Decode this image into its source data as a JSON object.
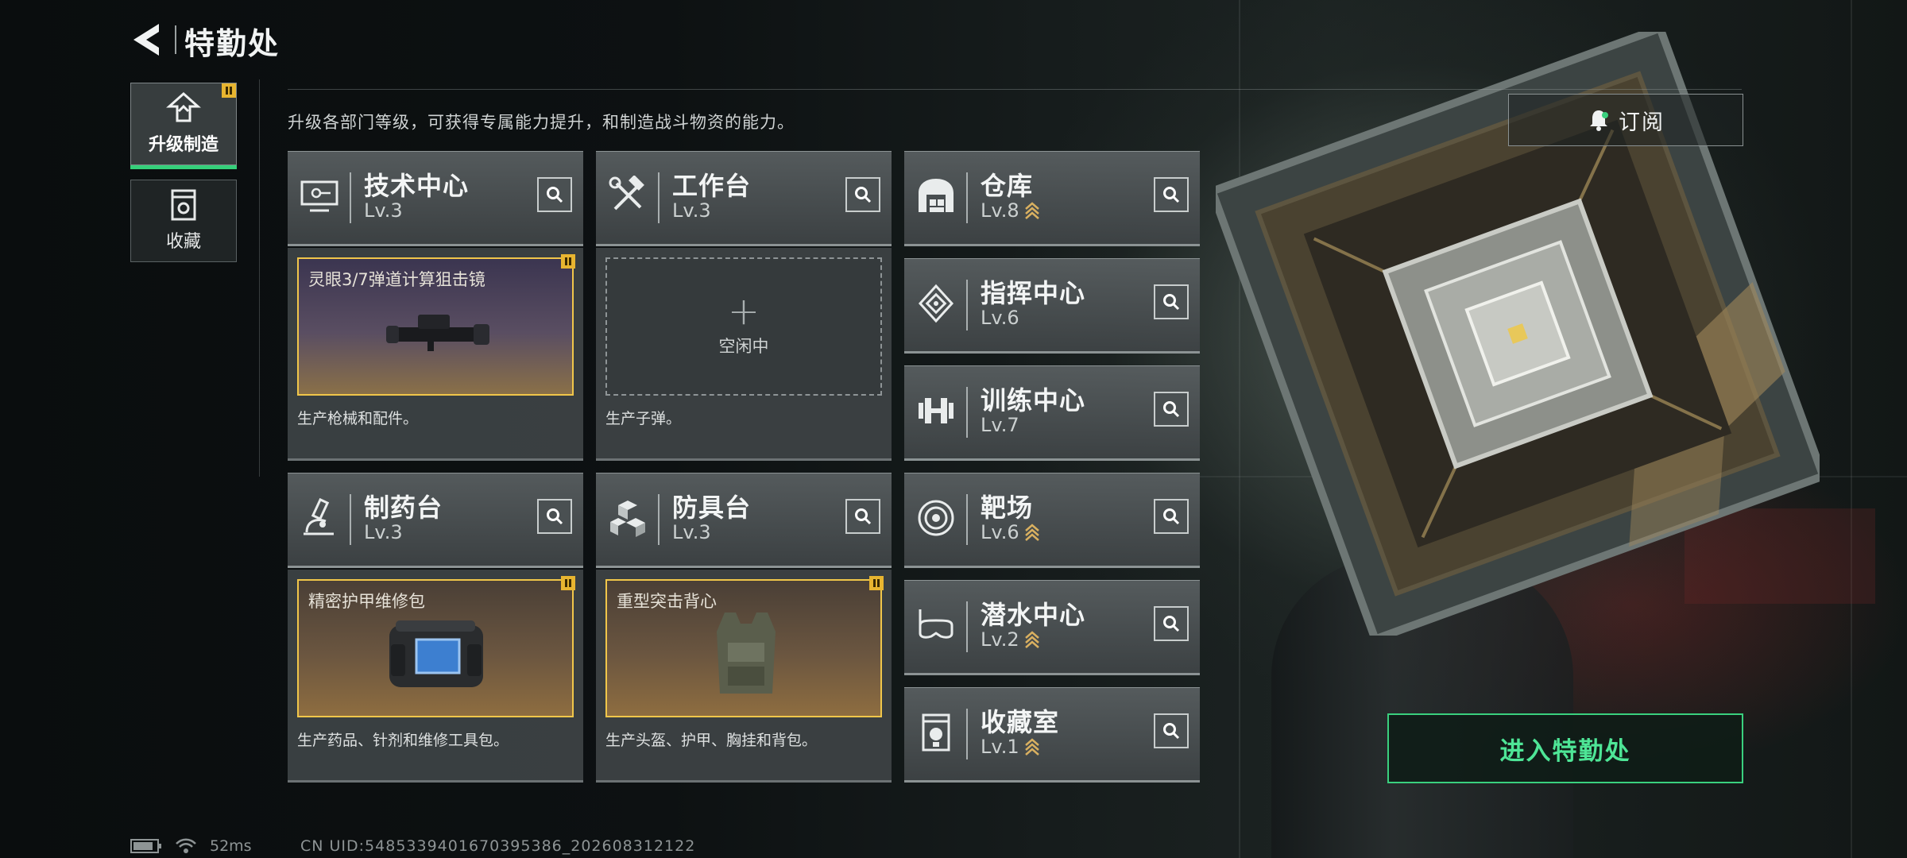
{
  "header": {
    "title": "特勤处"
  },
  "side_nav": [
    {
      "label": "升级制造",
      "active": true,
      "badge": true
    },
    {
      "label": "收藏",
      "active": false,
      "badge": false
    }
  ],
  "description": "升级各部门等级，可获得专属能力提升，和制造战斗物资的能力。",
  "subscribe_label": "订阅",
  "enter_label": "进入特勤处",
  "departments": {
    "tech": {
      "name": "技术中心",
      "level": "Lv.3"
    },
    "workbench": {
      "name": "工作台",
      "level": "Lv.3"
    },
    "pharmacy": {
      "name": "制药台",
      "level": "Lv.3"
    },
    "armor": {
      "name": "防具台",
      "level": "Lv.3"
    },
    "warehouse": {
      "name": "仓库",
      "level": "Lv.8"
    },
    "command": {
      "name": "指挥中心",
      "level": "Lv.6"
    },
    "training": {
      "name": "训练中心",
      "level": "Lv.7"
    },
    "range": {
      "name": "靶场",
      "level": "Lv.6"
    },
    "diving": {
      "name": "潜水中心",
      "level": "Lv.2"
    },
    "collection": {
      "name": "收藏室",
      "level": "Lv.1"
    }
  },
  "production": {
    "tech": {
      "item": "灵眼3/7弹道计算狙击镜",
      "caption": "生产枪械和配件。"
    },
    "workbench": {
      "idle": "空闲中",
      "caption": "生产子弹。"
    },
    "pharmacy": {
      "item": "精密护甲维修包",
      "caption": "生产药品、针剂和维修工具包。"
    },
    "armor": {
      "item": "重型突击背心",
      "caption": "生产头盔、护甲、胸挂和背包。"
    }
  },
  "footer": {
    "ping": "52ms",
    "uid": "CN UID:5485339401670395386_202608312122"
  },
  "colors": {
    "accent_green": "#3ad07e",
    "badge_yellow": "#e8b530",
    "slot_border": "#f0c64a"
  },
  "icons": [
    "back-icon",
    "upgrade-icon",
    "collection-icon",
    "search-icon",
    "bell-icon",
    "battery-icon",
    "wifi-icon",
    "upgrade-chevron-icon"
  ]
}
